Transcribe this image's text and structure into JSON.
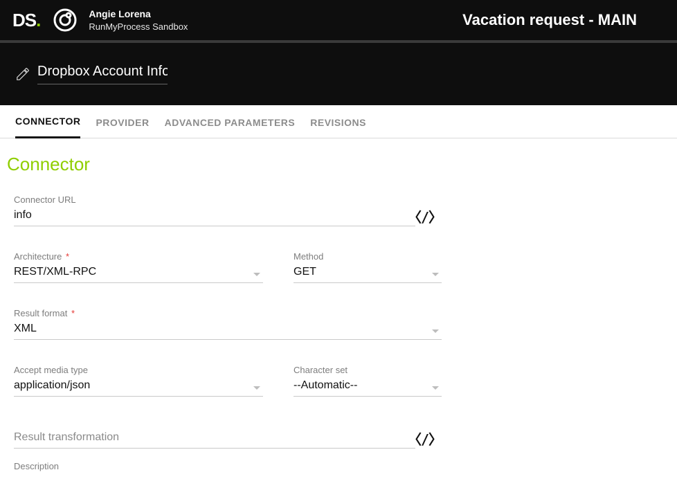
{
  "header": {
    "brand_a": "DS",
    "brand_dot": ".",
    "user_name": "Angie Lorena",
    "user_sub": "RunMyProcess Sandbox",
    "page_title": "Vacation request - MAIN"
  },
  "subheader": {
    "entity_name": "Dropbox Account Inform"
  },
  "tabs": {
    "connector": "CONNECTOR",
    "provider": "PROVIDER",
    "advanced": "ADVANCED PARAMETERS",
    "revisions": "REVISIONS"
  },
  "section": {
    "title": "Connector"
  },
  "form": {
    "connector_url": {
      "label": "Connector URL",
      "value": "info"
    },
    "architecture": {
      "label": "Architecture",
      "value": "REST/XML-RPC"
    },
    "method": {
      "label": "Method",
      "value": "GET"
    },
    "result_format": {
      "label": "Result format",
      "value": "XML"
    },
    "accept_media": {
      "label": "Accept media type",
      "value": "application/json"
    },
    "charset": {
      "label": "Character set",
      "value": "--Automatic--"
    },
    "result_transform": {
      "label": "Result transformation",
      "value": ""
    },
    "description": {
      "label": "Description"
    }
  },
  "glyphs": {
    "code": "〈/〉",
    "required": "*"
  }
}
